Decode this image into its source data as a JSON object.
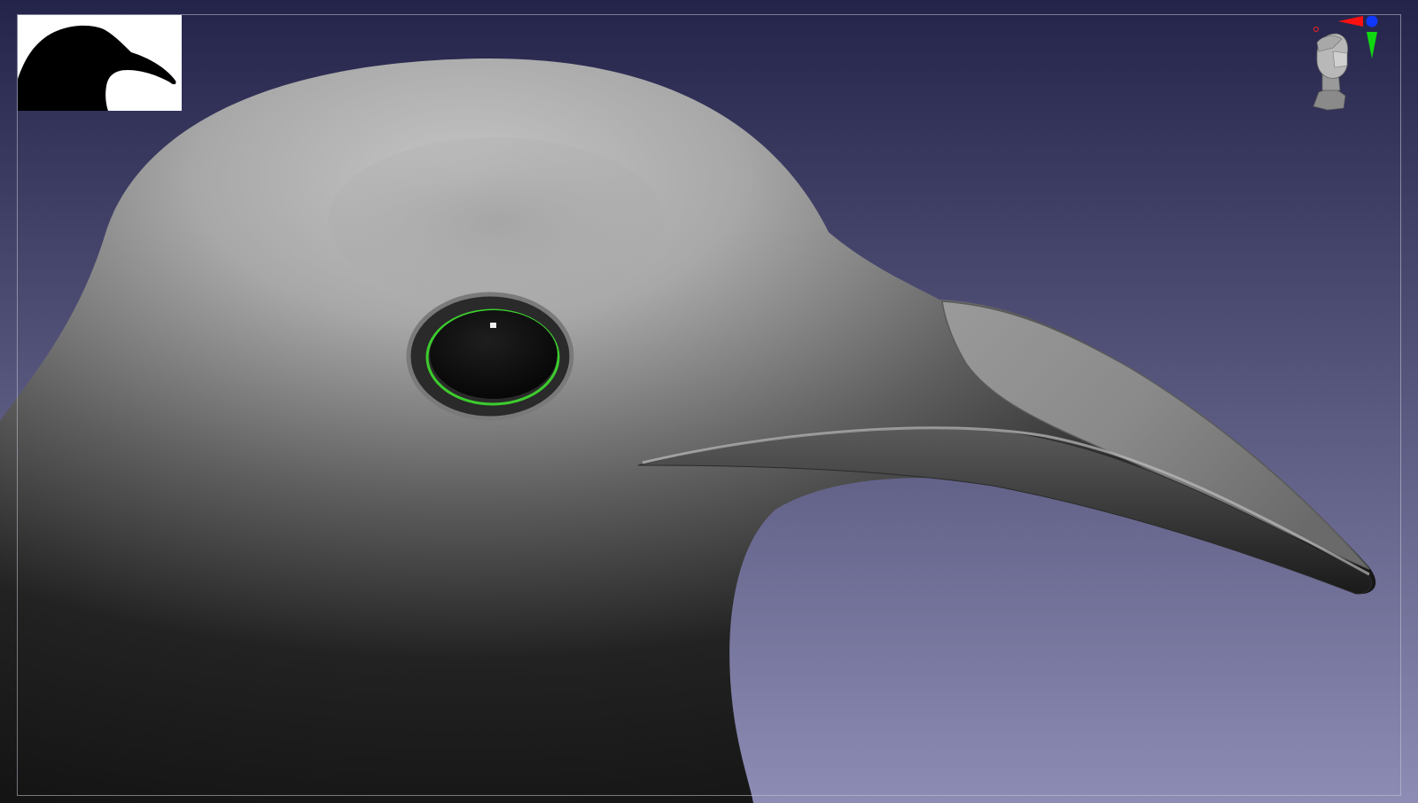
{
  "viewport": {
    "background_top": "#24244a",
    "background_bottom": "#8c8cb4",
    "frame_color": "#c8c8d7"
  },
  "model": {
    "surface_light": "#b9b9b9",
    "surface_mid": "#6e6e6e",
    "surface_dark": "#181818",
    "eye_highlight_rim": "#3dcc2e",
    "eye_color": "#060606"
  },
  "thumbnail": {
    "background": "#ffffff",
    "silhouette_color": "#000000"
  },
  "orientation_gizmo": {
    "icon": "head-icon",
    "axis_x_color": "#ff1010",
    "axis_y_color": "#10d810",
    "axis_z_color": "#1038ff",
    "indicator_color": "#ff2020"
  }
}
